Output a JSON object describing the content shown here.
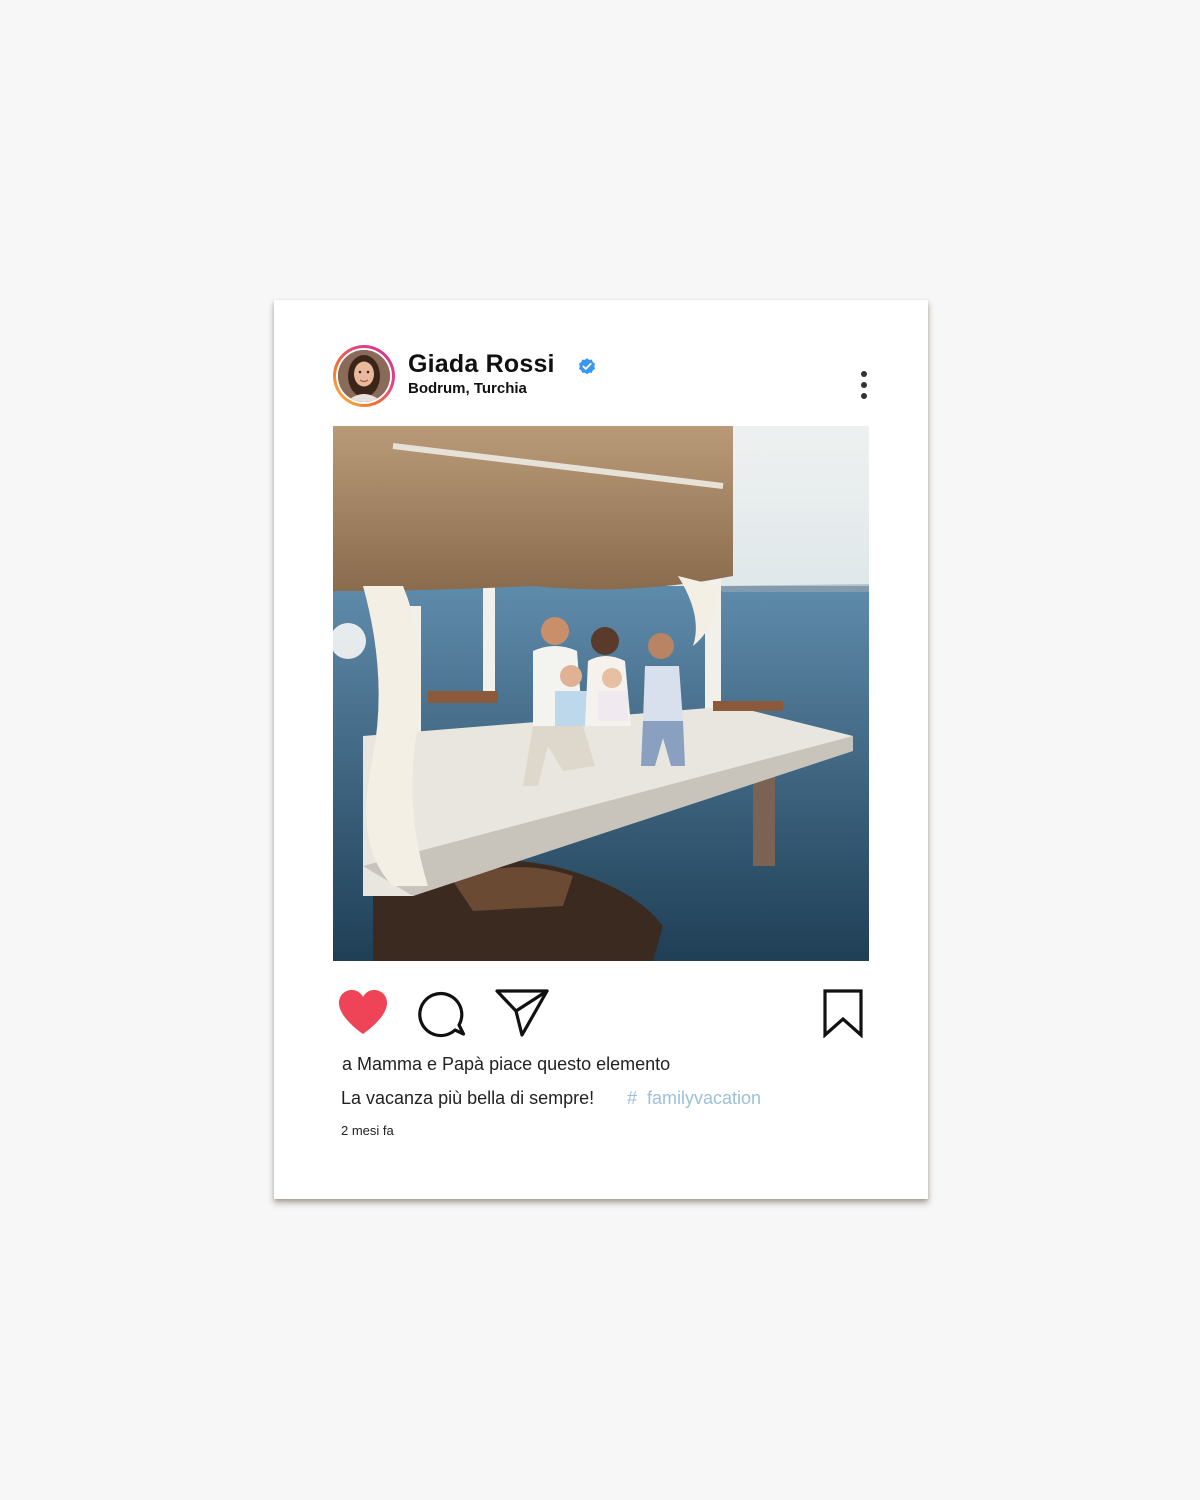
{
  "post": {
    "username": "Giada Rossi",
    "location": "Bodrum, Turchia",
    "verified": true,
    "liked": true,
    "likes_text": "a Mamma e Papà piace questo elemento",
    "caption": "La vacanza più bella di sempre!",
    "hashtag_symbol": "#",
    "hashtag": "familyvacation",
    "timestamp": "2 mesi fa"
  },
  "icons": {
    "verified": "verified-badge-icon",
    "more": "more-vertical-icon",
    "like": "heart-icon",
    "comment": "comment-bubble-icon",
    "share": "paper-plane-icon",
    "save": "bookmark-icon"
  },
  "colors": {
    "like": "#ef4458",
    "verified": "#3897f0",
    "hashtag": "#9ec0d9",
    "avatar_ring": [
      "#f9c74f",
      "#f3722c",
      "#e63e8a",
      "#c13584"
    ]
  }
}
